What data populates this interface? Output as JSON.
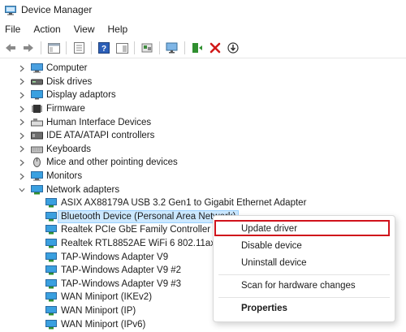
{
  "window": {
    "title": "Device Manager"
  },
  "menu": {
    "items": [
      "File",
      "Action",
      "View",
      "Help"
    ]
  },
  "toolbar": {
    "buttons": [
      "back-icon",
      "forward-icon",
      "show-hide-console-tree-icon",
      "properties-icon",
      "help-icon",
      "show-pane-icon",
      "update-driver-icon",
      "scan-hardware-icon",
      "enable-device-icon",
      "uninstall-icon",
      "disable-device-icon"
    ]
  },
  "tree": {
    "categories": [
      {
        "label": "Computer",
        "icon": "computer-icon"
      },
      {
        "label": "Disk drives",
        "icon": "disk-drive-icon"
      },
      {
        "label": "Display adaptors",
        "icon": "display-adapter-icon"
      },
      {
        "label": "Firmware",
        "icon": "firmware-icon"
      },
      {
        "label": "Human Interface Devices",
        "icon": "hid-icon"
      },
      {
        "label": "IDE ATA/ATAPI controllers",
        "icon": "ide-controller-icon"
      },
      {
        "label": "Keyboards",
        "icon": "keyboard-icon"
      },
      {
        "label": "Mice and other pointing devices",
        "icon": "mouse-icon"
      },
      {
        "label": "Monitors",
        "icon": "monitor-icon"
      },
      {
        "label": "Network adapters",
        "icon": "network-adapter-icon"
      }
    ],
    "network_adapters": [
      "ASIX AX88179A USB 3.2 Gen1 to Gigabit Ethernet Adapter",
      "Bluetooth Device (Personal Area Network)",
      "Realtek PCIe GbE Family Controller",
      "Realtek RTL8852AE WiFi 6 802.11ax PCI",
      "TAP-Windows Adapter V9",
      "TAP-Windows Adapter V9 #2",
      "TAP-Windows Adapter V9 #3",
      "WAN Miniport (IKEv2)",
      "WAN Miniport (IP)",
      "WAN Miniport (IPv6)"
    ],
    "selected": "Bluetooth Device (Personal Area Network)"
  },
  "context_menu": {
    "update_driver": "Update driver",
    "disable_device": "Disable device",
    "uninstall_device": "Uninstall device",
    "scan_hardware": "Scan for hardware changes",
    "properties": "Properties",
    "highlight_color": "#d0121b"
  }
}
